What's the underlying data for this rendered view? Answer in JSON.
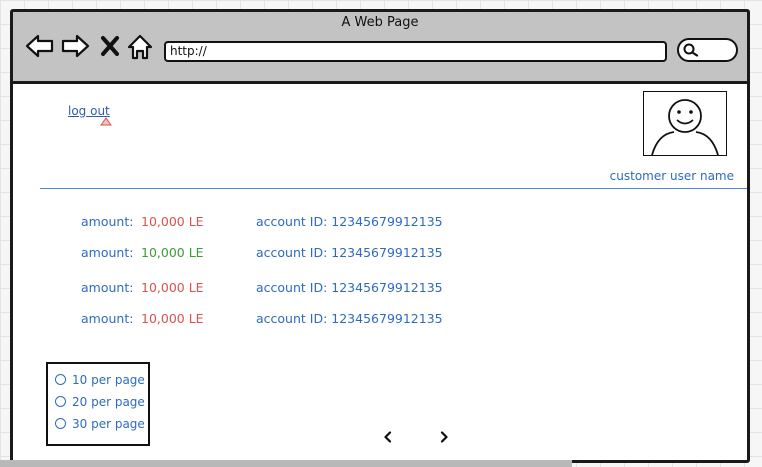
{
  "window": {
    "title": "A Web Page"
  },
  "toolbar": {
    "url": "http://"
  },
  "header": {
    "logout_label": "log out",
    "username": "customer user name"
  },
  "transactions": [
    {
      "amount_label": "amount:",
      "amount": "10,000 LE",
      "amount_color": "#d9534f",
      "account": "account ID: 12345679912135"
    },
    {
      "amount_label": "amount:",
      "amount": "10,000 LE",
      "amount_color": "#3c9a3c",
      "account": "account ID: 12345679912135"
    },
    {
      "amount_label": "amount:",
      "amount": "10,000 LE",
      "amount_color": "#d9534f",
      "account": "account ID: 12345679912135"
    },
    {
      "amount_label": "amount:",
      "amount": "10,000 LE",
      "amount_color": "#d9534f",
      "account": "account ID: 12345679912135"
    }
  ],
  "per_page_options": [
    "10 per page",
    "20 per page",
    "30 per page"
  ],
  "pagination": {
    "prev_icon": "chevron-left-icon",
    "next_icon": "chevron-right-icon"
  },
  "icons": [
    "back-arrow-icon",
    "forward-arrow-icon",
    "close-icon",
    "home-icon",
    "search-icon",
    "avatar-icon",
    "warning-icon"
  ],
  "colors": {
    "link_blue": "#2e6bbd",
    "negative": "#d9534f",
    "positive": "#3c9a3c",
    "chrome": "#c3c3c3"
  }
}
